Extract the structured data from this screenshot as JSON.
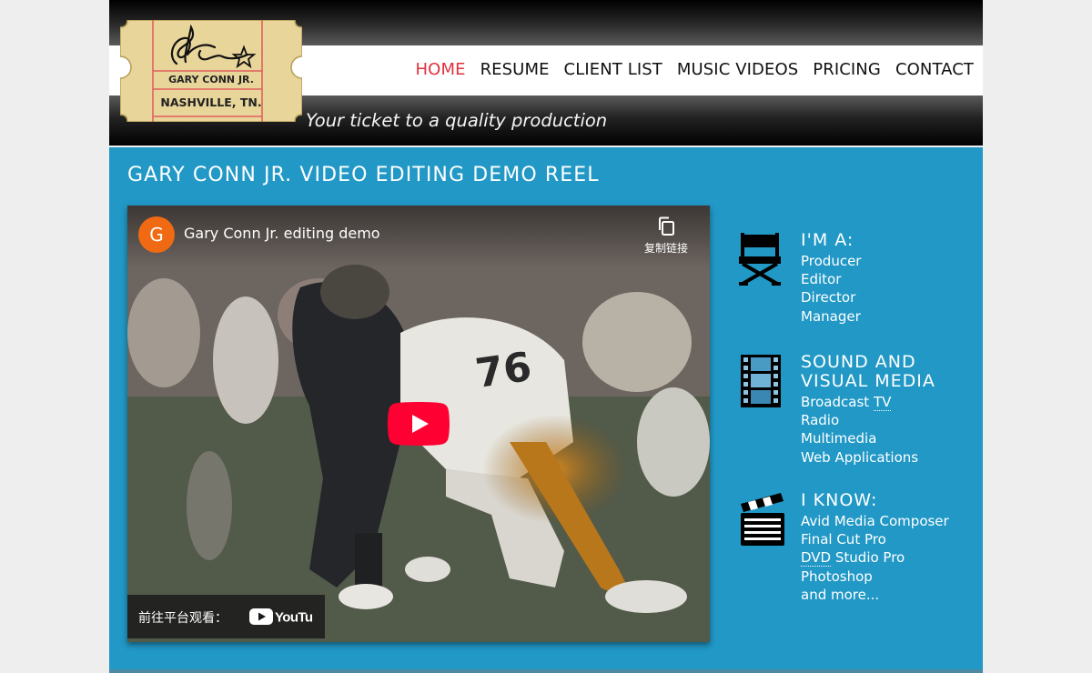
{
  "logo": {
    "name": "GARY CONN JR.",
    "city": "NASHVILLE, TN."
  },
  "nav": {
    "items": [
      {
        "label": "HOME",
        "active": true
      },
      {
        "label": "RESUME",
        "active": false
      },
      {
        "label": "CLIENT LIST",
        "active": false
      },
      {
        "label": "MUSIC VIDEOS",
        "active": false
      },
      {
        "label": "PRICING",
        "active": false
      },
      {
        "label": "CONTACT",
        "active": false
      }
    ]
  },
  "tagline": "Your ticket to a quality production",
  "page_title": "GARY CONN JR. VIDEO EDITING DEMO REEL",
  "video": {
    "channel_initial": "G",
    "title": "Gary Conn Jr. editing demo",
    "copy_link_label": "复制链接",
    "watch_on_label": "前往平台观看：",
    "youtube_label": "YouTube",
    "jersey_number": "76"
  },
  "sidebar": {
    "roles": {
      "heading": "I'M A:",
      "items": [
        "Producer",
        "Editor",
        "Director",
        "Manager"
      ]
    },
    "media": {
      "heading_line1": "SOUND AND",
      "heading_line2": "VISUAL MEDIA",
      "items": [
        "Broadcast",
        "TV",
        "Radio",
        "Multimedia",
        "Web Applications"
      ]
    },
    "skills": {
      "heading": "I KNOW:",
      "items": [
        "Avid Media Composer",
        "Final Cut Pro",
        "DVD",
        "Studio Pro",
        "Photoshop",
        "and more..."
      ]
    }
  },
  "colors": {
    "main_bg": "#2198c6",
    "nav_active": "#e0313c",
    "ticket": "#e8d59a",
    "play_red": "#ff0033"
  }
}
